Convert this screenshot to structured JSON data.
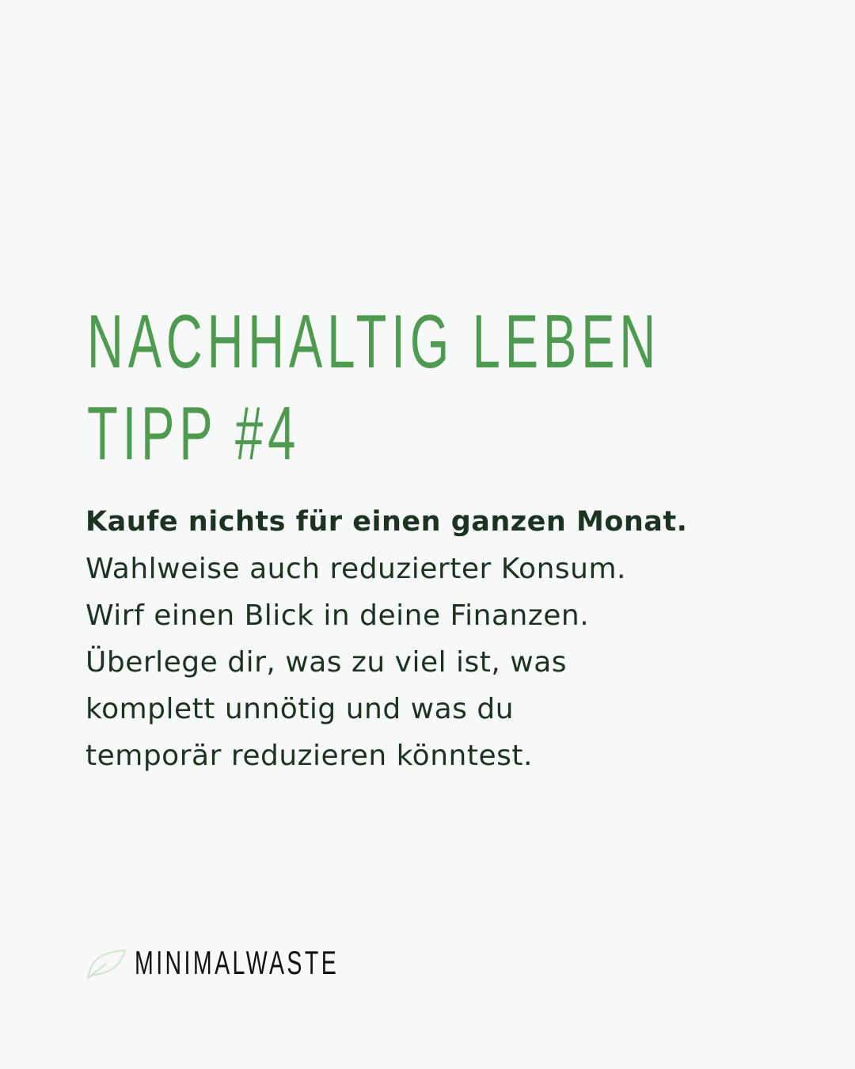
{
  "title": {
    "line1": "Nachhaltig Leben",
    "line2": "Tipp #4"
  },
  "body": {
    "lead": "Kaufe nichts für einen ganzen Monat.",
    "lines": [
      "Wahlweise auch reduzierter Konsum.",
      "Wirf einen Blick in deine Finanzen.",
      "Überlege dir, was zu viel ist, was",
      "komplett unnötig und was du",
      "temporär reduzieren könntest."
    ]
  },
  "brand": {
    "name": "minimalwaste",
    "icon": "leaf-icon"
  },
  "colors": {
    "accent": "#4e9a4f",
    "text": "#1d3321",
    "background": "#f7f9f8"
  }
}
